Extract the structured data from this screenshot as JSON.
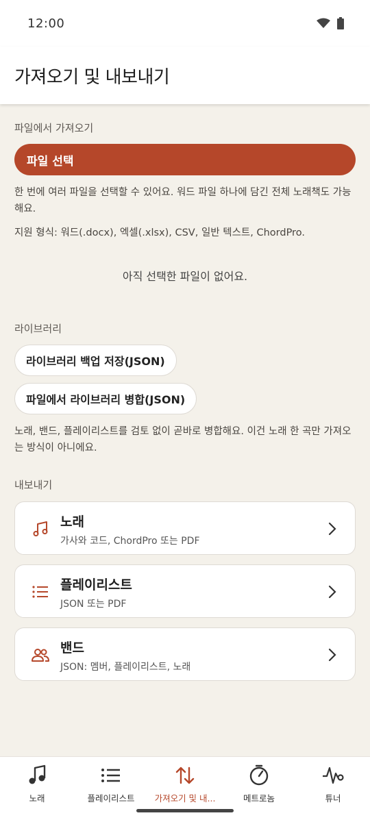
{
  "status_bar": {
    "time": "12:00",
    "icons": [
      "wifi-icon",
      "battery-icon"
    ]
  },
  "app_bar": {
    "title": "가져오기 및 내보내기"
  },
  "import_section": {
    "label": "파일에서 가져오기",
    "select_button": "파일 선택",
    "helper": "한 번에 여러 파일을 선택할 수 있어요. 워드 파일 하나에 담긴 전체 노래책도 가능해요.",
    "formats": "지원 형식: 워드(.docx), 엑셀(.xlsx), CSV, 일반 텍스트, ChordPro.",
    "empty": "아직 선택한 파일이 없어요."
  },
  "library_section": {
    "label": "라이브러리",
    "backup_button": "라이브러리 백업 저장(JSON)",
    "merge_button": "파일에서 라이브러리 병합(JSON)",
    "helper": "노래, 밴드, 플레이리스트를 검토 없이 곧바로 병합해요. 이건 노래 한 곡만 가져오는 방식이 아니에요."
  },
  "export_section": {
    "label": "내보내기",
    "items": [
      {
        "title": "노래",
        "subtitle": "가사와 코드, ChordPro 또는 PDF",
        "icon": "music-note-icon"
      },
      {
        "title": "플레이리스트",
        "subtitle": "JSON 또는 PDF",
        "icon": "list-icon"
      },
      {
        "title": "밴드",
        "subtitle": "JSON: 멤버, 플레이리스트, 노래",
        "icon": "people-icon"
      }
    ]
  },
  "bottom_nav": {
    "active": "import-export",
    "items": [
      {
        "label": "노래",
        "icon": "music-note-icon"
      },
      {
        "label": "플레이리스트",
        "icon": "list-icon"
      },
      {
        "label": "가져오기 및 내...",
        "icon": "swap-vertical-icon"
      },
      {
        "label": "메트로놈",
        "icon": "metronome-icon"
      },
      {
        "label": "튜너",
        "icon": "waveform-icon"
      }
    ]
  },
  "colors": {
    "accent": "#b5472a",
    "background": "#f4f1ea",
    "surface": "#ffffff"
  }
}
